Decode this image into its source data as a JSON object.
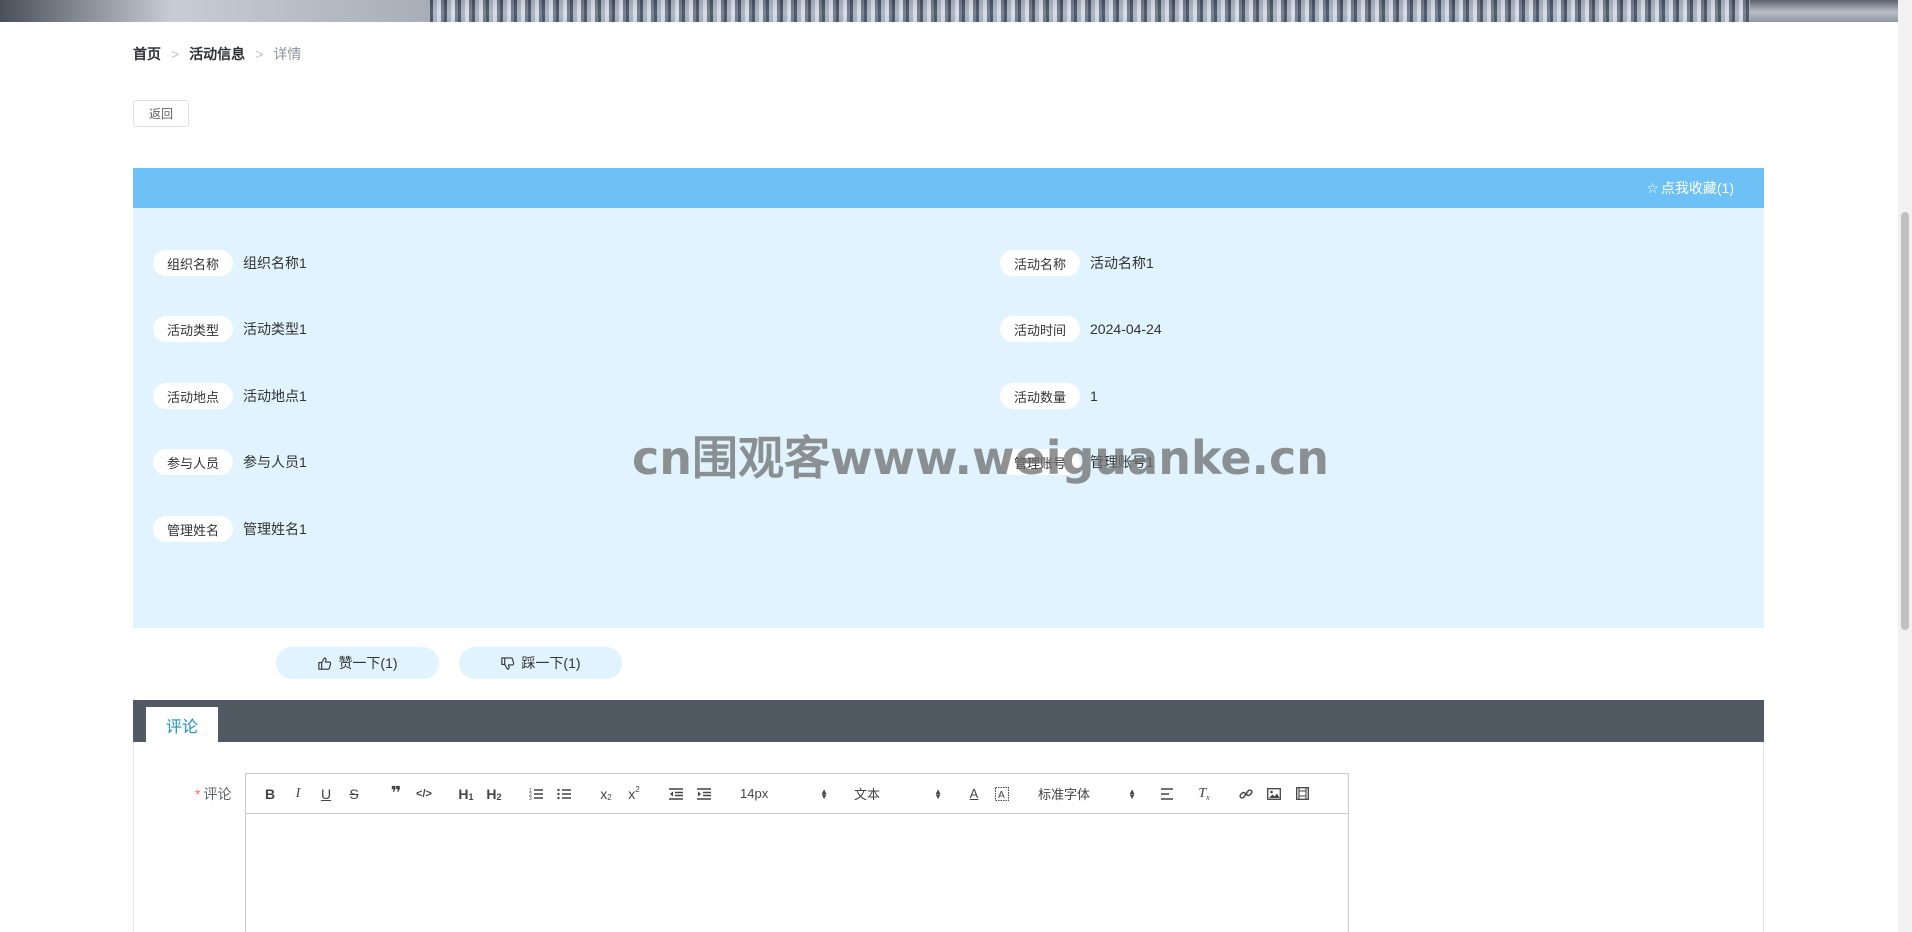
{
  "breadcrumb": {
    "home": "首页",
    "section": "活动信息",
    "current": "详情",
    "separator": ">"
  },
  "actions": {
    "back_label": "返回"
  },
  "detail": {
    "favorite_label": "点我收藏(1)",
    "fields_left": [
      {
        "label": "组织名称",
        "value": "组织名称1"
      },
      {
        "label": "活动类型",
        "value": "活动类型1"
      },
      {
        "label": "活动地点",
        "value": "活动地点1"
      },
      {
        "label": "参与人员",
        "value": "参与人员1"
      },
      {
        "label": "管理姓名",
        "value": "管理姓名1"
      }
    ],
    "fields_right": [
      {
        "label": "活动名称",
        "value": "活动名称1"
      },
      {
        "label": "活动时间",
        "value": "2024-04-24"
      },
      {
        "label": "活动数量",
        "value": "1"
      },
      {
        "label": "管理账号",
        "value": "管理账号1"
      }
    ],
    "header_color": "#6ec1f7",
    "body_color": "#e0f3fe"
  },
  "votes": {
    "like_label": "赞一下(1)",
    "dislike_label": "踩一下(1)"
  },
  "comment": {
    "tab_label": "评论",
    "field_label": "评论",
    "required_mark": "*",
    "toolbar": {
      "font_size": "14px",
      "block_type": "文本",
      "font_family": "标准字体"
    }
  },
  "watermark": "cn围观客www.weiguanke.cn"
}
